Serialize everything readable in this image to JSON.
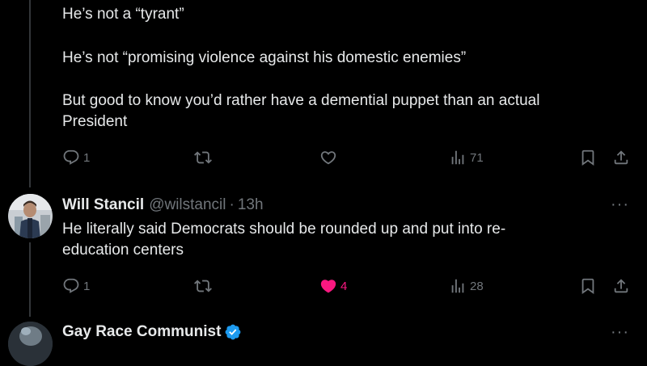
{
  "tweet1": {
    "lines": [
      "He’s not a “tyrant”",
      "He’s not “promising violence against his domestic enemies”",
      "But good to know you’d rather have a demential puppet than an actual",
      "President"
    ],
    "replies": "1",
    "views": "71"
  },
  "tweet2": {
    "name": "Will Stancil",
    "handle": "@wilstancil",
    "separator": "·",
    "time": "13h",
    "lines": [
      "He literally said Democrats should be rounded up and put into re-",
      "education centers"
    ],
    "replies": "1",
    "likes": "4",
    "views": "28",
    "more": "···"
  },
  "tweet3": {
    "name": "Gay Race Communist",
    "more": "···"
  },
  "colors": {
    "background": "#000000",
    "text": "#e7e9ea",
    "muted": "#71767b",
    "like": "#f91880",
    "verified": "#1d9bf0"
  },
  "icons": [
    "reply-icon",
    "retweet-icon",
    "like-icon",
    "views-icon",
    "bookmark-icon",
    "share-icon",
    "verified-icon",
    "more-icon"
  ]
}
